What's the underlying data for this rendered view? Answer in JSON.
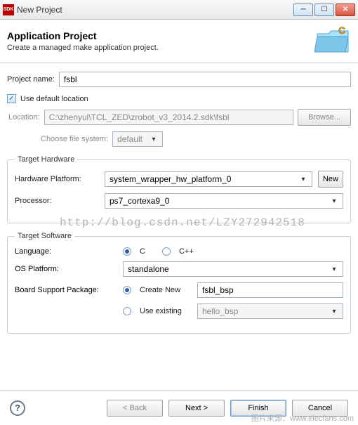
{
  "window": {
    "title": "New Project",
    "icon_label": "SDK"
  },
  "banner": {
    "title": "Application Project",
    "subtitle": "Create a managed make application project."
  },
  "project": {
    "name_label": "Project name:",
    "name_value": "fsbl",
    "use_default_label": "Use default location",
    "use_default_checked": true,
    "location_label": "Location:",
    "location_value": "C:\\zhenyul\\TCL_ZED\\zrobot_v3_2014.2.sdk\\fsbl",
    "browse_label": "Browse...",
    "choose_fs_label": "Choose file system:",
    "fs_value": "default"
  },
  "target_hw": {
    "legend": "Target Hardware",
    "hw_platform_label": "Hardware Platform:",
    "hw_platform_value": "system_wrapper_hw_platform_0",
    "new_btn": "New",
    "processor_label": "Processor:",
    "processor_value": "ps7_cortexa9_0"
  },
  "target_sw": {
    "legend": "Target Software",
    "language_label": "Language:",
    "lang_c": "C",
    "lang_cpp": "C++",
    "lang_selected": "C",
    "os_label": "OS Platform:",
    "os_value": "standalone",
    "bsp_label": "Board Support Package:",
    "create_new_label": "Create New",
    "create_new_value": "fsbl_bsp",
    "use_existing_label": "Use existing",
    "use_existing_value": "hello_bsp",
    "bsp_mode": "create_new"
  },
  "buttons": {
    "back": "< Back",
    "next": "Next >",
    "finish": "Finish",
    "cancel": "Cancel"
  },
  "watermark": "http://blog.csdn.net/LZY272942518",
  "site_watermark": "图片来源：www.elecfans.com"
}
